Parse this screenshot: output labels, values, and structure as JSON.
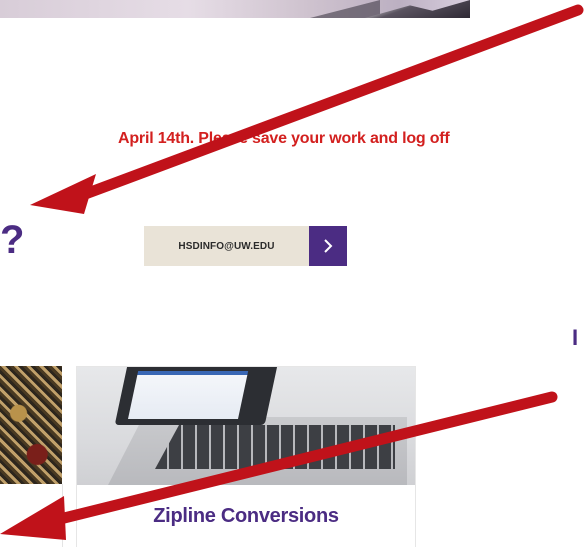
{
  "notice": {
    "text": "April 14th. Please save your work and log off"
  },
  "contact": {
    "email_label": "HSDINFO@UW.EDU",
    "go_icon": "chevron-right-icon"
  },
  "cards": [
    {
      "title": "Zipline Conversions"
    }
  ],
  "colors": {
    "uw_purple": "#4b2c83",
    "notice_red": "#d3201f",
    "arrow_red": "#c0121a",
    "email_bg": "#e9e3d7"
  }
}
